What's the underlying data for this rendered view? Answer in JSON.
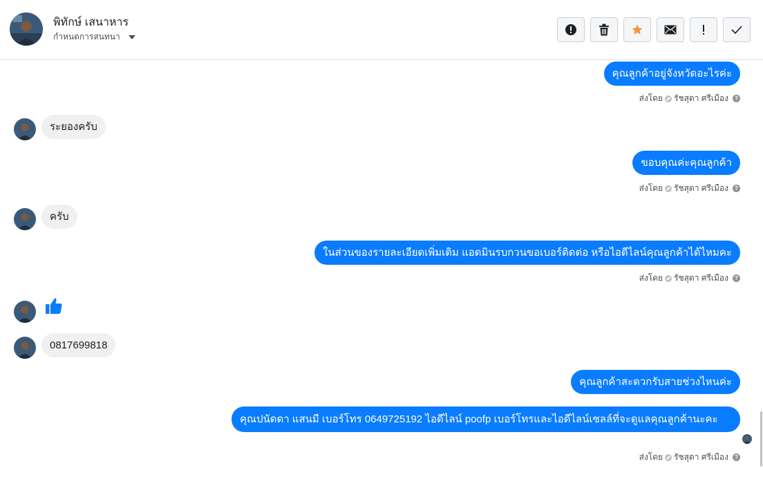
{
  "header": {
    "contact_name": "พิทักษ์ เสนาหาร",
    "label_dropdown": "กำหนดการสนทนา"
  },
  "toolbar": {
    "buttons": [
      {
        "icon": "alert-circle-icon",
        "name": "spam-button"
      },
      {
        "icon": "trash-icon",
        "name": "delete-button"
      },
      {
        "icon": "star-icon",
        "name": "star-button",
        "color": "#f7923b"
      },
      {
        "icon": "mail-icon",
        "name": "mark-unread-button"
      },
      {
        "icon": "exclamation-icon",
        "name": "follow-up-button"
      },
      {
        "icon": "check-icon",
        "name": "mark-done-button"
      }
    ]
  },
  "colors": {
    "outgoing_bubble": "#0a7cff",
    "incoming_bubble": "#f0f0f0",
    "like_icon": "#0a7cff"
  },
  "messages": {
    "m1": "คุณลูกค้าอยู่จังหวัดอะไรค่ะ",
    "m2": "ระยองครับ",
    "m3": "ขอบคุณค่ะคุณลูกค้า",
    "m4": "ครับ",
    "m5": "ในส่วนของรายละเอียดเพิ่มเติม แอดมินรบกวนขอเบอร์ติดต่อ หรือไอดีไลน์คุณลูกค้าได้ไหมคะ",
    "m6_icon": "thumbs-up-icon",
    "m7": "0817699818",
    "m8": "คุณลูกค้าสะดวกรับสายช่วงไหนค่ะ",
    "m9": "คุณปนัดดา แสนมี   เบอร์โทร 0649725192  ไอดีไลน์ poofp   เบอร์โทรและไอดีไลน์เซลล์ที่จะดูแลคุณลูกค้านะคะ"
  },
  "sent_by": {
    "prefix": "ส่งโดย",
    "agent": "รัชสุดา ศรีเมือง"
  }
}
